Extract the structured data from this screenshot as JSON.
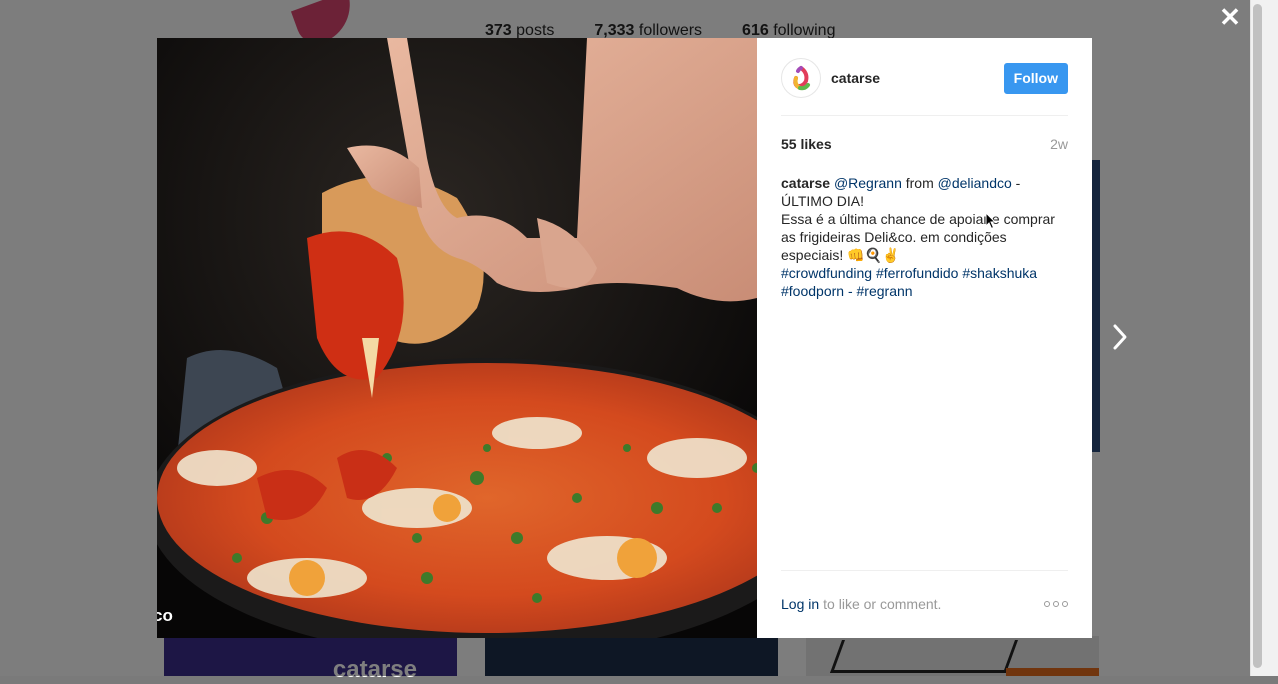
{
  "background": {
    "stats": [
      {
        "count": "373",
        "label": "posts"
      },
      {
        "count": "7,333",
        "label": "followers"
      },
      {
        "count": "616",
        "label": "following"
      }
    ],
    "tile_text": "catarse"
  },
  "modal": {
    "image_caption": "co",
    "header": {
      "username": "catarse",
      "follow_label": "Follow"
    },
    "likes": "55 likes",
    "time_ago": "2w",
    "caption": {
      "author": "catarse",
      "mention1": "@Regrann",
      "from_text": " from ",
      "mention2": "@deliandco",
      "dash": " -",
      "line2": "ÚLTIMO DIA!",
      "line3": "Essa é a última chance de apoiar e comprar as frigideiras Deli&co. em condições especiais! 👊🍳✌",
      "tags": [
        "#crowdfunding",
        "#ferrofundido",
        "#shakshuka",
        "#foodporn",
        "- #regrann"
      ]
    },
    "footer": {
      "login_label": "Log in",
      "login_text": "to like or comment."
    }
  },
  "icons": {
    "close": "close-icon",
    "next": "chevron-right-icon",
    "more": "more-options-icon"
  },
  "colors": {
    "follow_blue": "#3897f0",
    "link_blue": "#003569",
    "muted": "#999999"
  }
}
